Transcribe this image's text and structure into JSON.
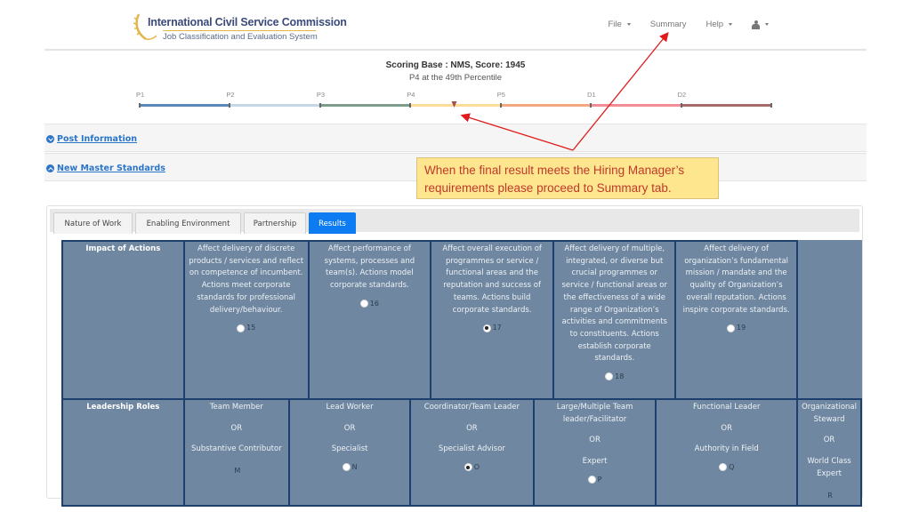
{
  "header": {
    "logo_title": "International Civil Service Commission",
    "logo_subtitle": "Job Classification and Evaluation System",
    "nav": [
      {
        "label": "File",
        "dropdown": true
      },
      {
        "label": "Summary",
        "dropdown": false
      },
      {
        "label": "Help",
        "dropdown": true
      },
      {
        "label": "",
        "icon": "user-icon",
        "dropdown": true
      }
    ]
  },
  "score": {
    "title": "Scoring Base : NMS, Score: 1945",
    "subtitle": "P4 at the 49th Percentile",
    "scale_labels": [
      "P1",
      "P2",
      "P3",
      "P4",
      "P5",
      "D1",
      "D2"
    ],
    "segment_colors": [
      "#5b86b8",
      "#c5d6e6",
      "#7e9c8c",
      "#fcdc97",
      "#f2a882",
      "#f38d95",
      "#a66a6a"
    ],
    "marker_grade": "P4",
    "marker_percentile": 49,
    "marker_color": "#a0524a"
  },
  "sections": [
    {
      "label": "Post Information",
      "icon": "chevron-down-circle-icon"
    },
    {
      "label": "New Master Standards",
      "icon": "chevron-up-circle-icon"
    }
  ],
  "annotation": {
    "text_line1": "When the final result meets the Hiring Manager’s",
    "text_line2": "requirements please proceed to Summary tab.",
    "color": "#c0392b",
    "background": "#fde68e"
  },
  "tabs": [
    {
      "label": "Nature of Work",
      "active": false
    },
    {
      "label": "Enabling Environment",
      "active": false
    },
    {
      "label": "Partnership",
      "active": false
    },
    {
      "label": "Results",
      "active": true
    }
  ],
  "results": {
    "impact": {
      "header": "Impact of Actions",
      "options": [
        {
          "text": "Affect delivery of discrete products / services and reflect on competence of incumbent. Actions meet corporate standards for professional delivery/behaviour.",
          "value": "15",
          "checked": false
        },
        {
          "text": "Affect performance of systems, processes and team(s). Actions model corporate standards.",
          "value": "16",
          "checked": false
        },
        {
          "text": "Affect overall execution of programmes or service / functional areas and the reputation and success of teams. Actions build corporate standards.",
          "value": "17",
          "checked": true
        },
        {
          "text": "Affect delivery of multiple, integrated, or diverse but crucial programmes or service / functional areas or the effectiveness of a wide range of Organization’s activities and commitments to constituents. Actions establish corporate standards.",
          "value": "18",
          "checked": false
        },
        {
          "text": "Affect delivery of organization’s fundamental mission / mandate and the quality of Organization’s overall reputation. Actions inspire corporate standards.",
          "value": "19",
          "checked": false
        }
      ]
    },
    "leadership": {
      "header": "Leadership Roles",
      "or_label": "OR",
      "options": [
        {
          "role": "Team Member",
          "alt": "Substantive Contributor",
          "value": "M",
          "has_radio": false,
          "checked": false
        },
        {
          "role": "Lead Worker",
          "alt": "Specialist",
          "value": "N",
          "has_radio": true,
          "checked": false
        },
        {
          "role": "Coordinator/Team Leader",
          "alt": "Specialist Advisor",
          "value": "O",
          "has_radio": true,
          "checked": true
        },
        {
          "role": "Large/Multiple Team leader/Facilitator",
          "alt": "Expert",
          "value": "P",
          "has_radio": true,
          "checked": false
        },
        {
          "role": "Functional Leader",
          "alt": "Authority in Field",
          "value": "Q",
          "has_radio": true,
          "checked": false
        },
        {
          "role": "Organizational Steward",
          "alt": "World Class Expert",
          "value": "R",
          "has_radio": false,
          "checked": false
        }
      ]
    }
  }
}
